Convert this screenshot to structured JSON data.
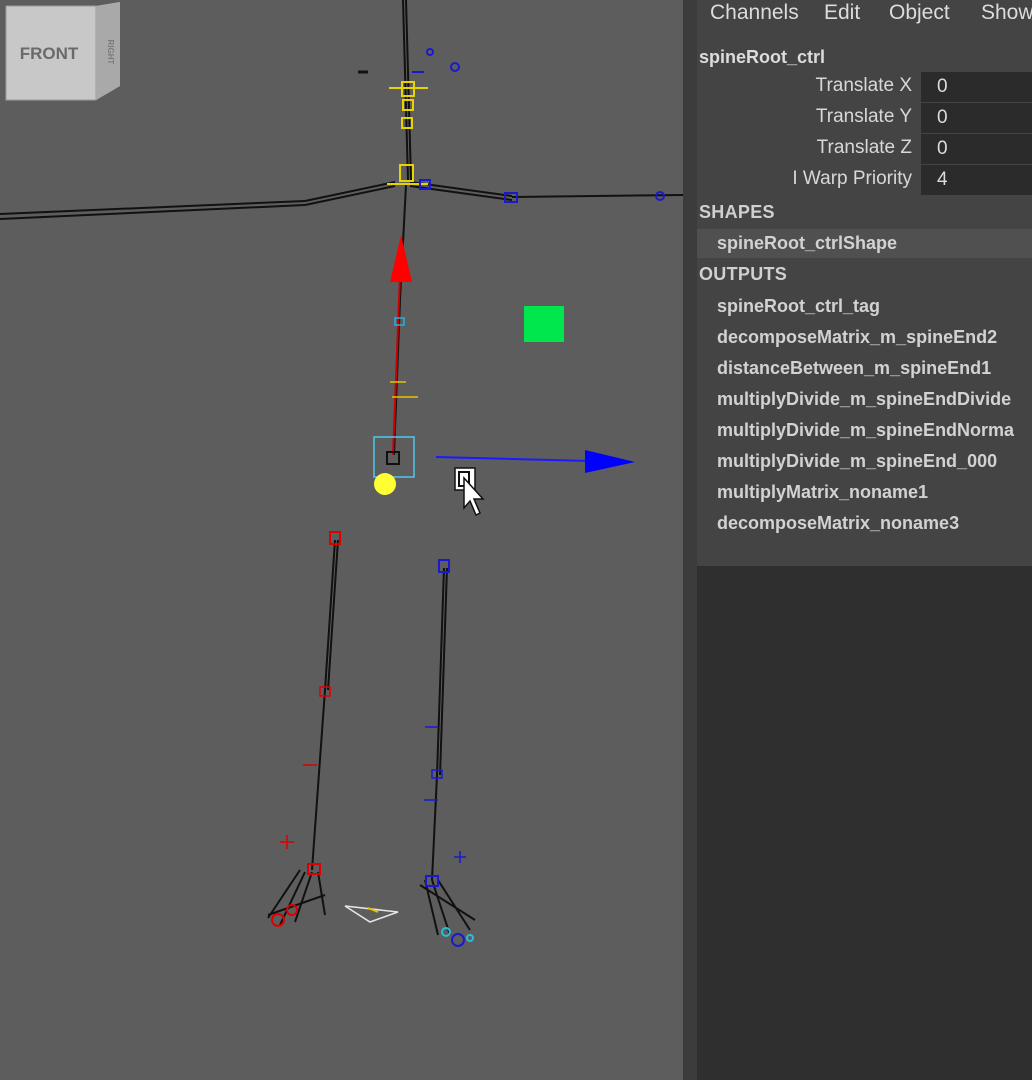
{
  "viewport": {
    "view_cube": {
      "front_label": "FRONT",
      "right_label": "RIGHT"
    }
  },
  "channel_box": {
    "menu": [
      "Channels",
      "Edit",
      "Object",
      "Show"
    ],
    "node_name": "spineRoot_ctrl",
    "attributes": [
      {
        "label": "Translate X",
        "value": "0"
      },
      {
        "label": "Translate Y",
        "value": "0"
      },
      {
        "label": "Translate Z",
        "value": "0"
      },
      {
        "label": "I Warp Priority",
        "value": "4"
      }
    ],
    "shapes_header": "SHAPES",
    "shapes": [
      "spineRoot_ctrlShape"
    ],
    "outputs_header": "OUTPUTS",
    "outputs": [
      "spineRoot_ctrl_tag",
      "decomposeMatrix_m_spineEnd2",
      "distanceBetween_m_spineEnd1",
      "multiplyDivide_m_spineEndDivide",
      "multiplyDivide_m_spineEndNorma",
      "multiplyDivide_m_spineEnd_000",
      "multiplyMatrix_noname1",
      "decomposeMatrix_noname3"
    ]
  },
  "colors": {
    "viewport_bg": "#5d5d5d",
    "panel_bg": "#444444",
    "field_bg": "#2b2b2b",
    "axis_x": "#ff0000",
    "axis_z": "#0000ff",
    "selection": "#00e64d",
    "joint_yellow": "#ffff33"
  }
}
